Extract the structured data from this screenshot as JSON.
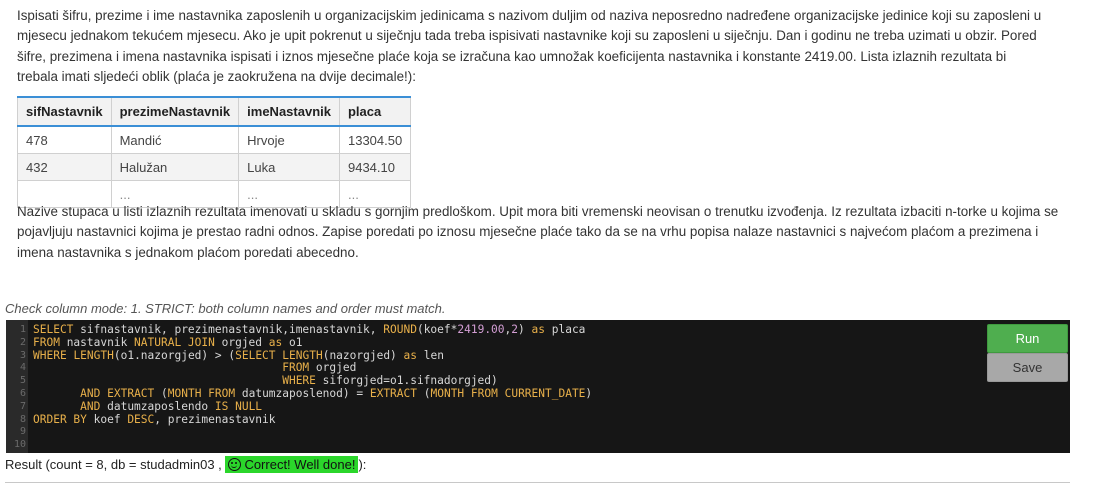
{
  "task": {
    "intro": "Ispisati šifru, prezime i ime nastavnika zaposlenih u organizacijskim jedinicama s nazivom duljim od naziva neposredno nadređene organizacijske jedinice koji su zaposleni u mjesecu jednakom tekućem mjesecu. Ako je upit pokrenut u siječnju tada treba ispisivati nastavnike koji su zaposleni u siječnju. Dan i godinu ne treba uzimati u obzir. Pored šifre, prezimena i imena nastavnika ispisati i iznos mjesečne plaće koja se izračuna kao umnožak koeficijenta nastavnika i konstante 2419.00. Lista izlaznih rezultata bi trebala imati sljedeći oblik (plaća je zaokružena na dvije decimale!):",
    "notes": "Nazive stupaca u listi izlaznih rezultata imenovati u skladu s gornjim predloškom. Upit mora biti vremenski neovisan o trenutku izvođenja. Iz rezultata izbaciti n-torke u kojima se pojavljuju nastavnici kojima je prestao radni odnos. Zapise poredati po iznosu mjesečne plaće tako da se na vrhu popisa nalaze nastavnici s najvećom plaćom a prezimena i imena nastavnika s jednakom plaćom poredati abecedno."
  },
  "example_table": {
    "headers": [
      "sifNastavnik",
      "prezimeNastavnik",
      "imeNastavnik",
      "placa"
    ],
    "rows": [
      [
        "478",
        "Mandić",
        "Hrvoje",
        "13304.50"
      ],
      [
        "432",
        "Halužan",
        "Luka",
        "9434.10"
      ],
      [
        "",
        "...",
        "...",
        "..."
      ]
    ]
  },
  "check_mode": "Check column mode: 1. STRICT: both column names and order must match.",
  "editor": {
    "line_numbers": [
      "1",
      "2",
      "3",
      "4",
      "5",
      "6",
      "7",
      "8",
      "9",
      "10"
    ],
    "lines": [
      [
        [
          "kw",
          "SELECT"
        ],
        [
          "t",
          " sifnastavnik, prezimenastavnik,imenastavnik, "
        ],
        [
          "fn",
          "ROUND"
        ],
        [
          "t",
          "(koef*"
        ],
        [
          "num",
          "2419.00"
        ],
        [
          "t",
          ","
        ],
        [
          "num",
          "2"
        ],
        [
          "t",
          ") "
        ],
        [
          "kw",
          "as"
        ],
        [
          "t",
          " placa"
        ]
      ],
      [
        [
          "kw",
          "FROM"
        ],
        [
          "t",
          " nastavnik "
        ],
        [
          "kw",
          "NATURAL JOIN"
        ],
        [
          "t",
          " orgjed "
        ],
        [
          "kw",
          "as"
        ],
        [
          "t",
          " o1"
        ]
      ],
      [
        [
          "kw",
          "WHERE"
        ],
        [
          "t",
          " "
        ],
        [
          "fn",
          "LENGTH"
        ],
        [
          "t",
          "(o1.nazorgjed) > ("
        ],
        [
          "kw",
          "SELECT"
        ],
        [
          "t",
          " "
        ],
        [
          "fn",
          "LENGTH"
        ],
        [
          "t",
          "(nazorgjed) "
        ],
        [
          "kw",
          "as"
        ],
        [
          "t",
          " len"
        ]
      ],
      [
        [
          "t",
          "                                     "
        ],
        [
          "kw",
          "FROM"
        ],
        [
          "t",
          " orgjed"
        ]
      ],
      [
        [
          "t",
          "                                     "
        ],
        [
          "kw",
          "WHERE"
        ],
        [
          "t",
          " siforgjed=o1.sifnadorgjed)"
        ]
      ],
      [
        [
          "t",
          "       "
        ],
        [
          "kw",
          "AND"
        ],
        [
          "t",
          " "
        ],
        [
          "fn",
          "EXTRACT"
        ],
        [
          "t",
          " ("
        ],
        [
          "kw",
          "MONTH FROM"
        ],
        [
          "t",
          " datumzaposlenod) = "
        ],
        [
          "fn",
          "EXTRACT"
        ],
        [
          "t",
          " ("
        ],
        [
          "kw",
          "MONTH FROM"
        ],
        [
          "t",
          " "
        ],
        [
          "kw",
          "CURRENT_DATE"
        ],
        [
          "t",
          ")"
        ]
      ],
      [
        [
          "t",
          "       "
        ],
        [
          "kw",
          "AND"
        ],
        [
          "t",
          " datumzaposlendo "
        ],
        [
          "kw",
          "IS NULL"
        ]
      ],
      [
        [
          "kw",
          "ORDER BY"
        ],
        [
          "t",
          " koef "
        ],
        [
          "kw",
          "DESC"
        ],
        [
          "t",
          ", prezimenastavnik"
        ]
      ],
      [],
      []
    ]
  },
  "buttons": {
    "run": "Run",
    "save": "Save"
  },
  "result": {
    "prefix": "Result (count = 8, db = studadmin03 ,",
    "message": "Correct! Well done!",
    "suffix": "):"
  },
  "colors": {
    "editor_bg": "#161616",
    "keyword": "#e8b04a",
    "number": "#d39ed4",
    "run_button": "#4fae4f",
    "save_button": "#a8a8a8",
    "success": "#2bd62b",
    "table_accent": "#3b8fd6"
  }
}
